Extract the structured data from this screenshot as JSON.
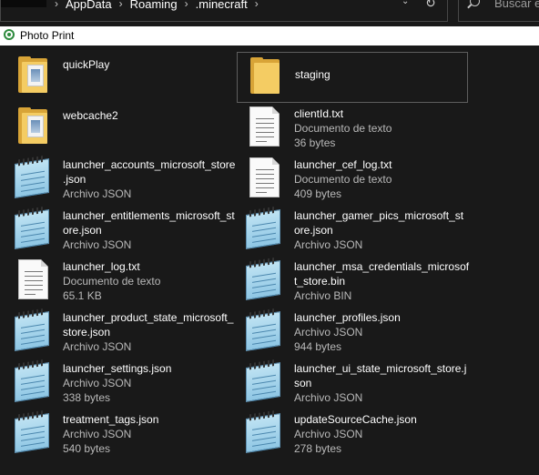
{
  "address": {
    "crumbs": [
      "AppData",
      "Roaming",
      ".minecraft"
    ],
    "search_placeholder": "Buscar en"
  },
  "bookmarks": {
    "label": "Photo Print"
  },
  "files": [
    {
      "name": "quickPlay",
      "type": "",
      "size": "",
      "icon": "folder-with-paper-icon"
    },
    {
      "name": "staging",
      "type": "",
      "size": "",
      "icon": "folder-icon",
      "selected": true
    },
    {
      "name": "webcache2",
      "type": "",
      "size": "",
      "icon": "folder-with-paper-icon"
    },
    {
      "name": "clientId.txt",
      "type": "Documento de texto",
      "size": "36 bytes",
      "icon": "text-document-icon"
    },
    {
      "name": "launcher_accounts_microsoft_store\n.json",
      "type": "Archivo JSON",
      "size": "",
      "icon": "json-file-icon"
    },
    {
      "name": "launcher_cef_log.txt",
      "type": "Documento de texto",
      "size": "409 bytes",
      "icon": "text-document-icon"
    },
    {
      "name": "launcher_entitlements_microsoft_st\nore.json",
      "type": "Archivo JSON",
      "size": "",
      "icon": "json-file-icon"
    },
    {
      "name": "launcher_gamer_pics_microsoft_st\nore.json",
      "type": "Archivo JSON",
      "size": "",
      "icon": "json-file-icon"
    },
    {
      "name": "launcher_log.txt",
      "type": "Documento de texto",
      "size": "65.1 KB",
      "icon": "text-document-icon"
    },
    {
      "name": "launcher_msa_credentials_microsof\nt_store.bin",
      "type": "Archivo BIN",
      "size": "",
      "icon": "json-file-icon"
    },
    {
      "name": "launcher_product_state_microsoft_\nstore.json",
      "type": "Archivo JSON",
      "size": "",
      "icon": "json-file-icon"
    },
    {
      "name": "launcher_profiles.json",
      "type": "Archivo JSON",
      "size": "944 bytes",
      "icon": "json-file-icon"
    },
    {
      "name": "launcher_settings.json",
      "type": "Archivo JSON",
      "size": "338 bytes",
      "icon": "json-file-icon"
    },
    {
      "name": "launcher_ui_state_microsoft_store.j\nson",
      "type": "Archivo JSON",
      "size": "",
      "icon": "json-file-icon"
    },
    {
      "name": "treatment_tags.json",
      "type": "Archivo JSON",
      "size": "540 bytes",
      "icon": "json-file-icon"
    },
    {
      "name": "updateSourceCache.json",
      "type": "Archivo JSON",
      "size": "278 bytes",
      "icon": "json-file-icon"
    }
  ]
}
